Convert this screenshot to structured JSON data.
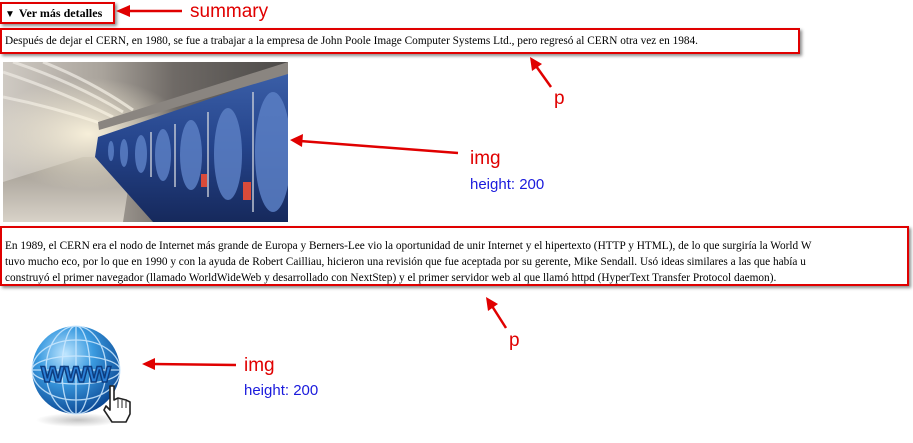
{
  "details": {
    "summary_text": "Ver más detalles",
    "paragraph_1": "Después de dejar el CERN, en 1980, se fue a trabajar a la empresa de John Poole Image Computer Systems Ltd., pero regresó al CERN otra vez en 1984.",
    "paragraph_2_lines": [
      "En 1989, el CERN era el nodo de Internet más grande de Europa y Berners-Lee vio la oportunidad de unir Internet y el hipertexto (HTTP y HTML), de lo que surgiría la World W",
      "tuvo mucho eco, por lo que en 1990 y con la ayuda de Robert Cailliau, hicieron una revisión que fue aceptada por su gerente, Mike Sendall. Usó ideas similares a las que había u",
      "construyó el primer navegador (llamado WorldWideWeb y desarrollado con NextStep) y el primer servidor web al que llamó httpd (HyperText Transfer Protocol daemon)."
    ],
    "www_text": "www"
  },
  "annotations": {
    "summary_label": "summary",
    "p1_label": "p",
    "img1_label": "img",
    "img1_height": "height: 200",
    "p2_label": "p",
    "img2_label": "img",
    "img2_height": "height: 200"
  },
  "colors": {
    "annotation_red": "#e00000",
    "annotation_blue": "#1a1adc"
  }
}
